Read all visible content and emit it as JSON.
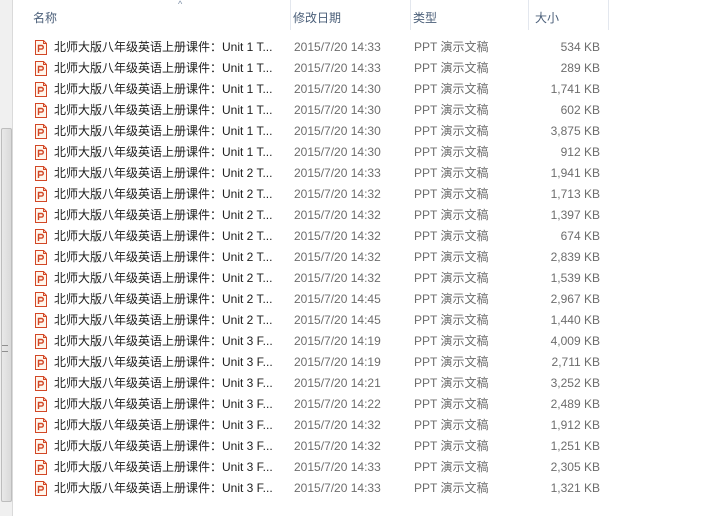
{
  "columns": {
    "name": "名称",
    "date": "修改日期",
    "type": "类型",
    "size": "大小",
    "sort_indicator": "^"
  },
  "icon": {
    "name": "powerpoint-file-icon",
    "accent": "#d24726",
    "fill": "#fff6ec"
  },
  "files": [
    {
      "name": "北师大版八年级英语上册课件：Unit 1 T...",
      "date": "2015/7/20 14:33",
      "type": "PPT 演示文稿",
      "size": "534 KB"
    },
    {
      "name": "北师大版八年级英语上册课件：Unit 1 T...",
      "date": "2015/7/20 14:33",
      "type": "PPT 演示文稿",
      "size": "289 KB"
    },
    {
      "name": "北师大版八年级英语上册课件：Unit 1 T...",
      "date": "2015/7/20 14:30",
      "type": "PPT 演示文稿",
      "size": "1,741 KB"
    },
    {
      "name": "北师大版八年级英语上册课件：Unit 1 T...",
      "date": "2015/7/20 14:30",
      "type": "PPT 演示文稿",
      "size": "602 KB"
    },
    {
      "name": "北师大版八年级英语上册课件：Unit 1 T...",
      "date": "2015/7/20 14:30",
      "type": "PPT 演示文稿",
      "size": "3,875 KB"
    },
    {
      "name": "北师大版八年级英语上册课件：Unit 1 T...",
      "date": "2015/7/20 14:30",
      "type": "PPT 演示文稿",
      "size": "912 KB"
    },
    {
      "name": "北师大版八年级英语上册课件：Unit 2 T...",
      "date": "2015/7/20 14:33",
      "type": "PPT 演示文稿",
      "size": "1,941 KB"
    },
    {
      "name": "北师大版八年级英语上册课件：Unit 2 T...",
      "date": "2015/7/20 14:32",
      "type": "PPT 演示文稿",
      "size": "1,713 KB"
    },
    {
      "name": "北师大版八年级英语上册课件：Unit 2 T...",
      "date": "2015/7/20 14:32",
      "type": "PPT 演示文稿",
      "size": "1,397 KB"
    },
    {
      "name": "北师大版八年级英语上册课件：Unit 2 T...",
      "date": "2015/7/20 14:32",
      "type": "PPT 演示文稿",
      "size": "674 KB"
    },
    {
      "name": "北师大版八年级英语上册课件：Unit 2 T...",
      "date": "2015/7/20 14:32",
      "type": "PPT 演示文稿",
      "size": "2,839 KB"
    },
    {
      "name": "北师大版八年级英语上册课件：Unit 2 T...",
      "date": "2015/7/20 14:32",
      "type": "PPT 演示文稿",
      "size": "1,539 KB"
    },
    {
      "name": "北师大版八年级英语上册课件：Unit 2 T...",
      "date": "2015/7/20 14:45",
      "type": "PPT 演示文稿",
      "size": "2,967 KB"
    },
    {
      "name": "北师大版八年级英语上册课件：Unit 2 T...",
      "date": "2015/7/20 14:45",
      "type": "PPT 演示文稿",
      "size": "1,440 KB"
    },
    {
      "name": "北师大版八年级英语上册课件：Unit 3 F...",
      "date": "2015/7/20 14:19",
      "type": "PPT 演示文稿",
      "size": "4,009 KB"
    },
    {
      "name": "北师大版八年级英语上册课件：Unit 3 F...",
      "date": "2015/7/20 14:19",
      "type": "PPT 演示文稿",
      "size": "2,711 KB"
    },
    {
      "name": "北师大版八年级英语上册课件：Unit 3 F...",
      "date": "2015/7/20 14:21",
      "type": "PPT 演示文稿",
      "size": "3,252 KB"
    },
    {
      "name": "北师大版八年级英语上册课件：Unit 3 F...",
      "date": "2015/7/20 14:22",
      "type": "PPT 演示文稿",
      "size": "2,489 KB"
    },
    {
      "name": "北师大版八年级英语上册课件：Unit 3 F...",
      "date": "2015/7/20 14:32",
      "type": "PPT 演示文稿",
      "size": "1,912 KB"
    },
    {
      "name": "北师大版八年级英语上册课件：Unit 3 F...",
      "date": "2015/7/20 14:32",
      "type": "PPT 演示文稿",
      "size": "1,251 KB"
    },
    {
      "name": "北师大版八年级英语上册课件：Unit 3 F...",
      "date": "2015/7/20 14:33",
      "type": "PPT 演示文稿",
      "size": "2,305 KB"
    },
    {
      "name": "北师大版八年级英语上册课件：Unit 3 F...",
      "date": "2015/7/20 14:33",
      "type": "PPT 演示文稿",
      "size": "1,321 KB"
    }
  ]
}
